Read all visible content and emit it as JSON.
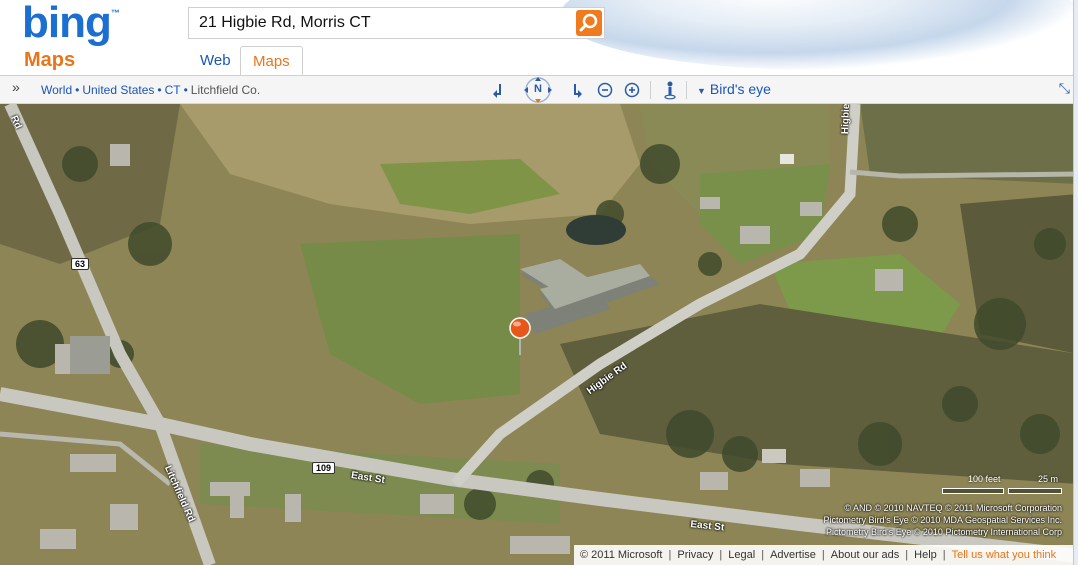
{
  "brand": {
    "logo_text": "bing",
    "section": "Maps"
  },
  "search": {
    "value": "21 Higbie Rd, Morris CT"
  },
  "tabs": [
    {
      "label": "Web"
    },
    {
      "label": "Maps"
    }
  ],
  "breadcrumb": {
    "items": [
      "World",
      "United States",
      "CT",
      "Litchfield Co."
    ]
  },
  "toolbar": {
    "compass_label": "N",
    "view_mode": "Bird's eye"
  },
  "map": {
    "road_labels": [
      "Higbie Rd",
      "Higbie Rd",
      "East St",
      "East St",
      "Litchfield Rd"
    ],
    "shields": [
      "63",
      "109"
    ],
    "scale": {
      "feet": "100 feet",
      "meters": "25 m"
    },
    "copyright": [
      "© AND  © 2010 NAVTEQ  © 2011 Microsoft Corporation",
      "Pictometry Bird's Eye © 2010 MDA Geospatial Services Inc.",
      "Pictometry Bird's Eye © 2010 Pictometry International Corp"
    ]
  },
  "footer": {
    "copyright": "© 2011 Microsoft",
    "links": [
      "Privacy",
      "Legal",
      "Advertise",
      "About our ads",
      "Help"
    ],
    "feedback": "Tell us what you think"
  },
  "colors": {
    "brand_blue": "#1c6fd0",
    "accent_orange": "#e8751a",
    "link_blue": "#1a56b8"
  }
}
